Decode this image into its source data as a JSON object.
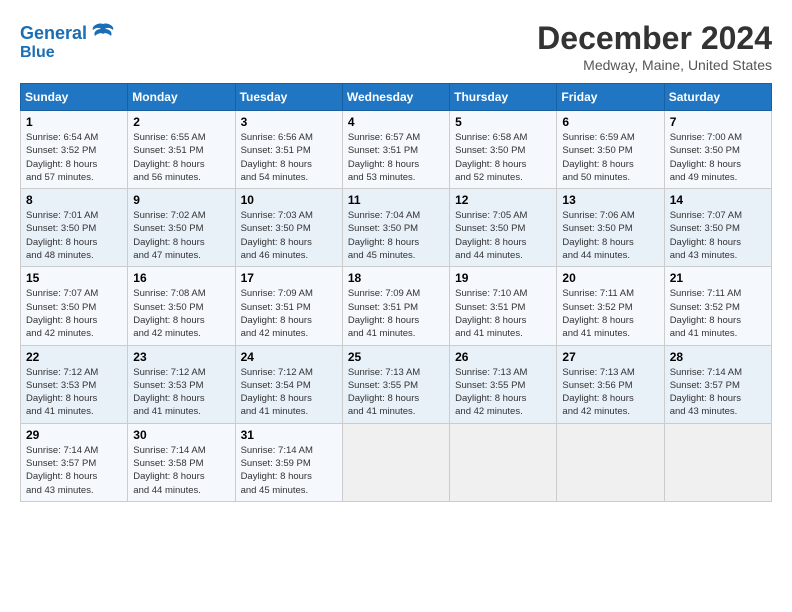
{
  "header": {
    "logo_line1": "General",
    "logo_line2": "Blue",
    "month": "December 2024",
    "location": "Medway, Maine, United States"
  },
  "days_of_week": [
    "Sunday",
    "Monday",
    "Tuesday",
    "Wednesday",
    "Thursday",
    "Friday",
    "Saturday"
  ],
  "weeks": [
    [
      {
        "day": 1,
        "lines": [
          "Sunrise: 6:54 AM",
          "Sunset: 3:52 PM",
          "Daylight: 8 hours",
          "and 57 minutes."
        ]
      },
      {
        "day": 2,
        "lines": [
          "Sunrise: 6:55 AM",
          "Sunset: 3:51 PM",
          "Daylight: 8 hours",
          "and 56 minutes."
        ]
      },
      {
        "day": 3,
        "lines": [
          "Sunrise: 6:56 AM",
          "Sunset: 3:51 PM",
          "Daylight: 8 hours",
          "and 54 minutes."
        ]
      },
      {
        "day": 4,
        "lines": [
          "Sunrise: 6:57 AM",
          "Sunset: 3:51 PM",
          "Daylight: 8 hours",
          "and 53 minutes."
        ]
      },
      {
        "day": 5,
        "lines": [
          "Sunrise: 6:58 AM",
          "Sunset: 3:50 PM",
          "Daylight: 8 hours",
          "and 52 minutes."
        ]
      },
      {
        "day": 6,
        "lines": [
          "Sunrise: 6:59 AM",
          "Sunset: 3:50 PM",
          "Daylight: 8 hours",
          "and 50 minutes."
        ]
      },
      {
        "day": 7,
        "lines": [
          "Sunrise: 7:00 AM",
          "Sunset: 3:50 PM",
          "Daylight: 8 hours",
          "and 49 minutes."
        ]
      }
    ],
    [
      {
        "day": 8,
        "lines": [
          "Sunrise: 7:01 AM",
          "Sunset: 3:50 PM",
          "Daylight: 8 hours",
          "and 48 minutes."
        ]
      },
      {
        "day": 9,
        "lines": [
          "Sunrise: 7:02 AM",
          "Sunset: 3:50 PM",
          "Daylight: 8 hours",
          "and 47 minutes."
        ]
      },
      {
        "day": 10,
        "lines": [
          "Sunrise: 7:03 AM",
          "Sunset: 3:50 PM",
          "Daylight: 8 hours",
          "and 46 minutes."
        ]
      },
      {
        "day": 11,
        "lines": [
          "Sunrise: 7:04 AM",
          "Sunset: 3:50 PM",
          "Daylight: 8 hours",
          "and 45 minutes."
        ]
      },
      {
        "day": 12,
        "lines": [
          "Sunrise: 7:05 AM",
          "Sunset: 3:50 PM",
          "Daylight: 8 hours",
          "and 44 minutes."
        ]
      },
      {
        "day": 13,
        "lines": [
          "Sunrise: 7:06 AM",
          "Sunset: 3:50 PM",
          "Daylight: 8 hours",
          "and 44 minutes."
        ]
      },
      {
        "day": 14,
        "lines": [
          "Sunrise: 7:07 AM",
          "Sunset: 3:50 PM",
          "Daylight: 8 hours",
          "and 43 minutes."
        ]
      }
    ],
    [
      {
        "day": 15,
        "lines": [
          "Sunrise: 7:07 AM",
          "Sunset: 3:50 PM",
          "Daylight: 8 hours",
          "and 42 minutes."
        ]
      },
      {
        "day": 16,
        "lines": [
          "Sunrise: 7:08 AM",
          "Sunset: 3:50 PM",
          "Daylight: 8 hours",
          "and 42 minutes."
        ]
      },
      {
        "day": 17,
        "lines": [
          "Sunrise: 7:09 AM",
          "Sunset: 3:51 PM",
          "Daylight: 8 hours",
          "and 42 minutes."
        ]
      },
      {
        "day": 18,
        "lines": [
          "Sunrise: 7:09 AM",
          "Sunset: 3:51 PM",
          "Daylight: 8 hours",
          "and 41 minutes."
        ]
      },
      {
        "day": 19,
        "lines": [
          "Sunrise: 7:10 AM",
          "Sunset: 3:51 PM",
          "Daylight: 8 hours",
          "and 41 minutes."
        ]
      },
      {
        "day": 20,
        "lines": [
          "Sunrise: 7:11 AM",
          "Sunset: 3:52 PM",
          "Daylight: 8 hours",
          "and 41 minutes."
        ]
      },
      {
        "day": 21,
        "lines": [
          "Sunrise: 7:11 AM",
          "Sunset: 3:52 PM",
          "Daylight: 8 hours",
          "and 41 minutes."
        ]
      }
    ],
    [
      {
        "day": 22,
        "lines": [
          "Sunrise: 7:12 AM",
          "Sunset: 3:53 PM",
          "Daylight: 8 hours",
          "and 41 minutes."
        ]
      },
      {
        "day": 23,
        "lines": [
          "Sunrise: 7:12 AM",
          "Sunset: 3:53 PM",
          "Daylight: 8 hours",
          "and 41 minutes."
        ]
      },
      {
        "day": 24,
        "lines": [
          "Sunrise: 7:12 AM",
          "Sunset: 3:54 PM",
          "Daylight: 8 hours",
          "and 41 minutes."
        ]
      },
      {
        "day": 25,
        "lines": [
          "Sunrise: 7:13 AM",
          "Sunset: 3:55 PM",
          "Daylight: 8 hours",
          "and 41 minutes."
        ]
      },
      {
        "day": 26,
        "lines": [
          "Sunrise: 7:13 AM",
          "Sunset: 3:55 PM",
          "Daylight: 8 hours",
          "and 42 minutes."
        ]
      },
      {
        "day": 27,
        "lines": [
          "Sunrise: 7:13 AM",
          "Sunset: 3:56 PM",
          "Daylight: 8 hours",
          "and 42 minutes."
        ]
      },
      {
        "day": 28,
        "lines": [
          "Sunrise: 7:14 AM",
          "Sunset: 3:57 PM",
          "Daylight: 8 hours",
          "and 43 minutes."
        ]
      }
    ],
    [
      {
        "day": 29,
        "lines": [
          "Sunrise: 7:14 AM",
          "Sunset: 3:57 PM",
          "Daylight: 8 hours",
          "and 43 minutes."
        ]
      },
      {
        "day": 30,
        "lines": [
          "Sunrise: 7:14 AM",
          "Sunset: 3:58 PM",
          "Daylight: 8 hours",
          "and 44 minutes."
        ]
      },
      {
        "day": 31,
        "lines": [
          "Sunrise: 7:14 AM",
          "Sunset: 3:59 PM",
          "Daylight: 8 hours",
          "and 45 minutes."
        ]
      },
      null,
      null,
      null,
      null
    ]
  ]
}
